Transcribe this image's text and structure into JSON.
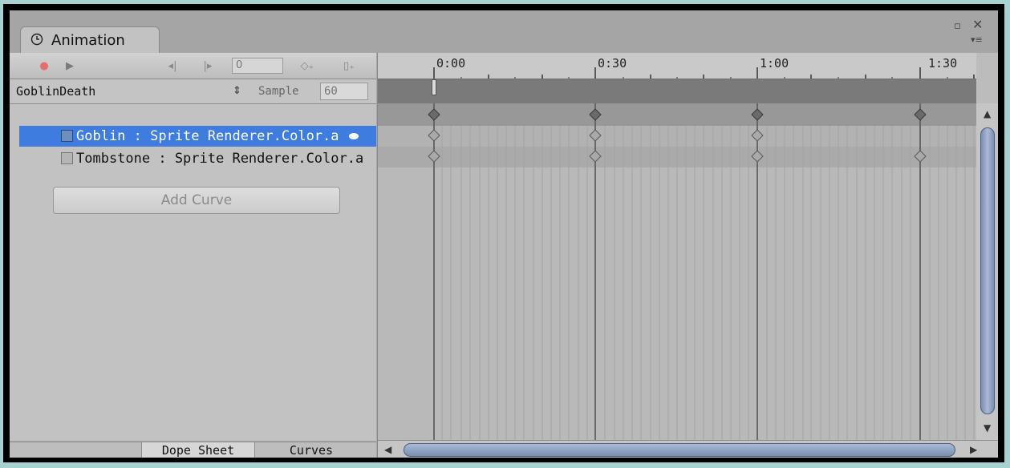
{
  "window": {
    "tab_title": "Animation",
    "clock_icon": "clock-icon",
    "maximize_glyph": "▫",
    "close_glyph": "✕",
    "menu_glyph": "▾≡"
  },
  "toolbar": {
    "record_glyph": "●",
    "play_glyph": "▶",
    "prev_key_glyph": "◂|",
    "next_key_glyph": "|▸",
    "frame_value": "0",
    "add_keyframe_glyph": "◇₊",
    "add_event_glyph": "▯₊"
  },
  "clip": {
    "name": "GoblinDeath",
    "arrow": "⇕",
    "sample_label": "Sample",
    "sample_value": "60"
  },
  "properties": [
    {
      "label": "Goblin : Sprite Renderer.Color.a",
      "selected": true
    },
    {
      "label": "Tombstone : Sprite Renderer.Color.a",
      "selected": false
    }
  ],
  "add_curve_label": "Add Curve",
  "bottom_tabs": {
    "dope_sheet": "Dope Sheet",
    "curves": "Curves"
  },
  "timeline": {
    "tick_labels": [
      "0:00",
      "0:30",
      "1:00",
      "1:30"
    ],
    "key_times": [
      "0:00",
      "0:30",
      "1:00",
      "1:30"
    ]
  },
  "colors": {
    "selection": "#3e7ce0",
    "record": "#e07070"
  }
}
